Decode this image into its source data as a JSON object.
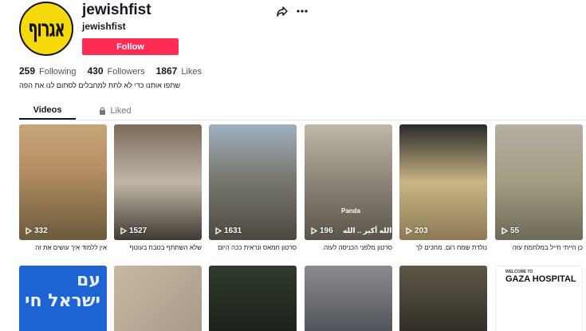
{
  "profile": {
    "avatar_text": "אגרוף",
    "username": "jewishfist",
    "nickname": "jewishfist",
    "follow_label": "Follow",
    "bio": "שתפו אותנו כדי לא לתת למחבלים לסתום לנו את הפה"
  },
  "actions": {
    "share_icon": "share-icon",
    "more_icon": "more-icon"
  },
  "stats": [
    {
      "value": "259",
      "label": "Following"
    },
    {
      "value": "430",
      "label": "Followers"
    },
    {
      "value": "1867",
      "label": "Likes"
    }
  ],
  "tabs": {
    "videos": "Videos",
    "liked": "Liked"
  },
  "videos_row1": [
    {
      "views": "332",
      "caption": "אין ללמוד איך עושים את זה"
    },
    {
      "views": "1527",
      "caption": "שלא השתתף בטבח בעוטף"
    },
    {
      "views": "1631",
      "caption": "סרטון חמאס ונראית ככה היום"
    },
    {
      "views": "196",
      "caption": "סרטון מלפני הכניסה לעזה.",
      "overlay": "Panda",
      "overlay2": "الله أكبر .. الله"
    },
    {
      "views": "203",
      "caption": "נולדת שמח רום. מחכים לך"
    },
    {
      "views": "55",
      "caption": "כן הייתי חייל במלחמת עזה"
    }
  ],
  "videos_row2": [
    {
      "overlay": "עם ישראל חי"
    },
    {
      "overlay": ""
    },
    {
      "overlay": ""
    },
    {
      "overlay": ""
    },
    {
      "overlay": ""
    },
    {
      "overlay_small": "WELCOME TO",
      "overlay": "GAZA HOSPITAL"
    }
  ],
  "colors": {
    "follow": "#fe2c55",
    "text": "#161823",
    "avatar_bg": "#f5d90a"
  }
}
